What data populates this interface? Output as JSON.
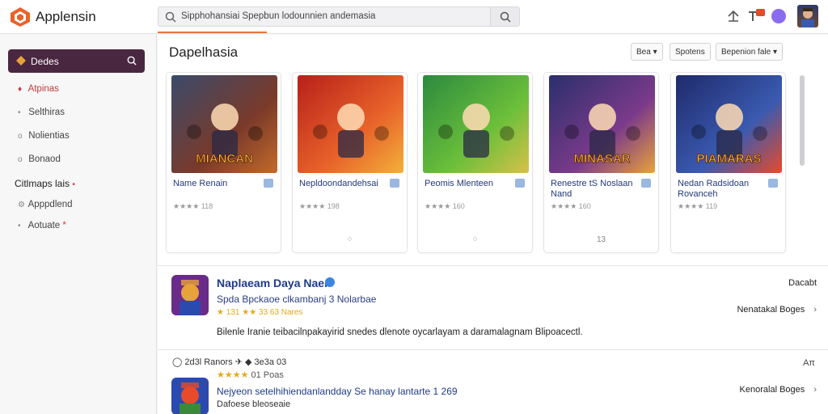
{
  "app": {
    "title": "Applensin"
  },
  "search": {
    "value": "Sipphohansiai Spepbun lodounnien andemasia"
  },
  "sidebar": {
    "header": "Dedes",
    "items": [
      {
        "label": "Atpinas",
        "bullet": "♦"
      },
      {
        "label": "Selthiras",
        "bullet": "•"
      },
      {
        "label": "Nolientias",
        "bullet": "o"
      },
      {
        "label": "Bonaod",
        "bullet": "o"
      }
    ],
    "section": "Citlmaps lais",
    "section_mark": "•",
    "sub_items": [
      {
        "label": "Apppdlend",
        "bullet": "⚙"
      },
      {
        "label": "Aotuate",
        "bullet": "•",
        "mark": "*"
      }
    ]
  },
  "main": {
    "section_title": "Dapelhasia",
    "filters": [
      "Bea ▾",
      "Spotens",
      "Bepenion fale ▾"
    ],
    "cards": [
      {
        "title": "Name Renain",
        "rating": "★★★★ 118",
        "footer": "",
        "art_text": "MIANCAN",
        "colors": [
          "#3a4a6b",
          "#7a3a2a",
          "#c46a2a"
        ]
      },
      {
        "title": "Nepldoondandehsai",
        "rating": "★★★★ 198",
        "footer": "⁘",
        "art_text": "",
        "colors": [
          "#b81f1a",
          "#e8632a",
          "#f2b03a"
        ]
      },
      {
        "title": "Peomis Mlenteen",
        "rating": "★★★★ 160",
        "footer": "⁘",
        "art_text": "",
        "colors": [
          "#2b8a3e",
          "#6bbf3a",
          "#d8c04a"
        ]
      },
      {
        "title": "Renestre tS Noslaan Nand",
        "rating": "★★★★ 160",
        "footer": "13",
        "art_text": "MINASAR",
        "colors": [
          "#2a2f6b",
          "#7a3a8a",
          "#e8a23a"
        ]
      },
      {
        "title": "Nedan Radsidoan Rovanceh",
        "rating": "★★★★ 119",
        "footer": "",
        "art_text": "PIAMARAS",
        "colors": [
          "#1f2a6b",
          "#3a5ab0",
          "#e84a2a"
        ]
      }
    ]
  },
  "featured": {
    "title": "Naplaeam Daya Naer",
    "subtitle": "Spda  Bpckaoe clkambanj  3 Nolarbae",
    "rating": "★ 131  ★★ 33  63 Nares",
    "description": "Bilenle Iranie teibacilnpakayirid snedes dlenote oycarlayam a daramalagnam Blipoacectl.",
    "right_label": "Dacabt",
    "link": "Nenatakal Boges",
    "colors": [
      "#6a2a8a",
      "#e8a23a",
      "#2a4ab0"
    ]
  },
  "list_item": {
    "meta": "◯ 2d3l    Ranors   ✈   ◆  3e3a   03",
    "stars": "★★★★",
    "stars_text": "01 Poas",
    "right_label": "Aπ",
    "title": "Nejyeon setelhihiendanlandday Se hanay lantarte 1 269",
    "subtitle": "Dafoese bleoseaie",
    "link": "Kenoralal Boges",
    "colors": [
      "#2a4ab0",
      "#e84a2a",
      "#3a8a3a"
    ]
  }
}
